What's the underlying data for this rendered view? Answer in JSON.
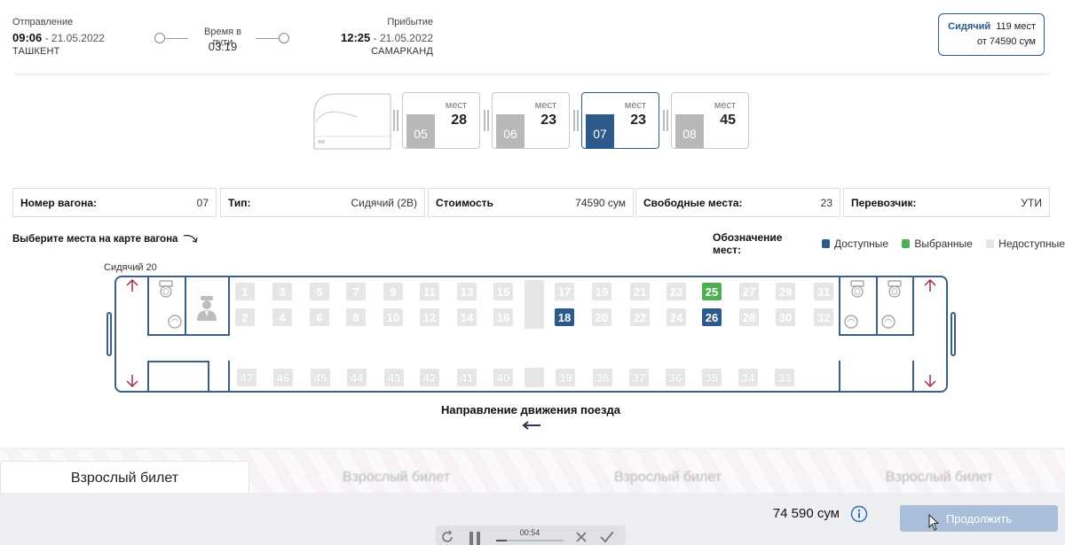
{
  "trip": {
    "departure": {
      "label": "Отправление",
      "time": "09:06",
      "date": "21.05.2022",
      "city": "ТАШКЕНТ"
    },
    "duration": {
      "label": "Время в пути",
      "value": "03:19"
    },
    "arrival": {
      "label": "Прибытие",
      "time": "12:25",
      "date": "21.05.2022",
      "city": "САМАРКАНД"
    },
    "date_sep": " - "
  },
  "class_box": {
    "name": "Сидячий",
    "seats": "119 мест",
    "price": "от 74590 сум"
  },
  "wagons": [
    {
      "number": "05",
      "seats_label": "мест",
      "seats": "28",
      "active": false
    },
    {
      "number": "06",
      "seats_label": "мест",
      "seats": "23",
      "active": false
    },
    {
      "number": "07",
      "seats_label": "мест",
      "seats": "23",
      "active": true
    },
    {
      "number": "08",
      "seats_label": "мест",
      "seats": "45",
      "active": false
    }
  ],
  "info": [
    {
      "key": "Номер вагона:",
      "value": "07"
    },
    {
      "key": "Тип:",
      "value": "Сидячий (2В)"
    },
    {
      "key": "Стоимость",
      "value": "74590 сум"
    },
    {
      "key": "Свободные места:",
      "value": "23"
    },
    {
      "key": "Перевозчик:",
      "value": "УТИ"
    }
  ],
  "seat_map": {
    "prompt": "Выберите места на карте вагона",
    "legend_title": "Обозначение мест:",
    "legend": [
      {
        "label": "Доступные",
        "color": "#2d5a8a"
      },
      {
        "label": "Выбранные",
        "color": "#4caf50"
      },
      {
        "label": "Недоступные",
        "color": "#e6e6e6"
      }
    ],
    "car_label": "Сидячий 20",
    "direction_label": "Направление движения поезда",
    "row_top": [
      "1",
      "3",
      "5",
      "7",
      "9",
      "11",
      "13",
      "15",
      "",
      "17",
      "19",
      "21",
      "23",
      "25",
      "27",
      "29",
      "31"
    ],
    "row_mid": [
      "2",
      "4",
      "6",
      "8",
      "10",
      "12",
      "14",
      "16",
      "",
      "18",
      "20",
      "22",
      "24",
      "26",
      "28",
      "30",
      "32"
    ],
    "row_bottom": [
      "47",
      "46",
      "45",
      "44",
      "43",
      "42",
      "41",
      "40",
      "",
      "39",
      "38",
      "37",
      "36",
      "35",
      "34",
      "33"
    ],
    "available": [
      "18",
      "26"
    ],
    "selected": [
      "25"
    ]
  },
  "tabs": [
    "Взрослый билет",
    "Взрослый билет",
    "Взрослый билет",
    "Взрослый билет"
  ],
  "footer": {
    "total": "74 590 сум",
    "continue_label": "Продолжить"
  },
  "player": {
    "time": "00:54"
  }
}
